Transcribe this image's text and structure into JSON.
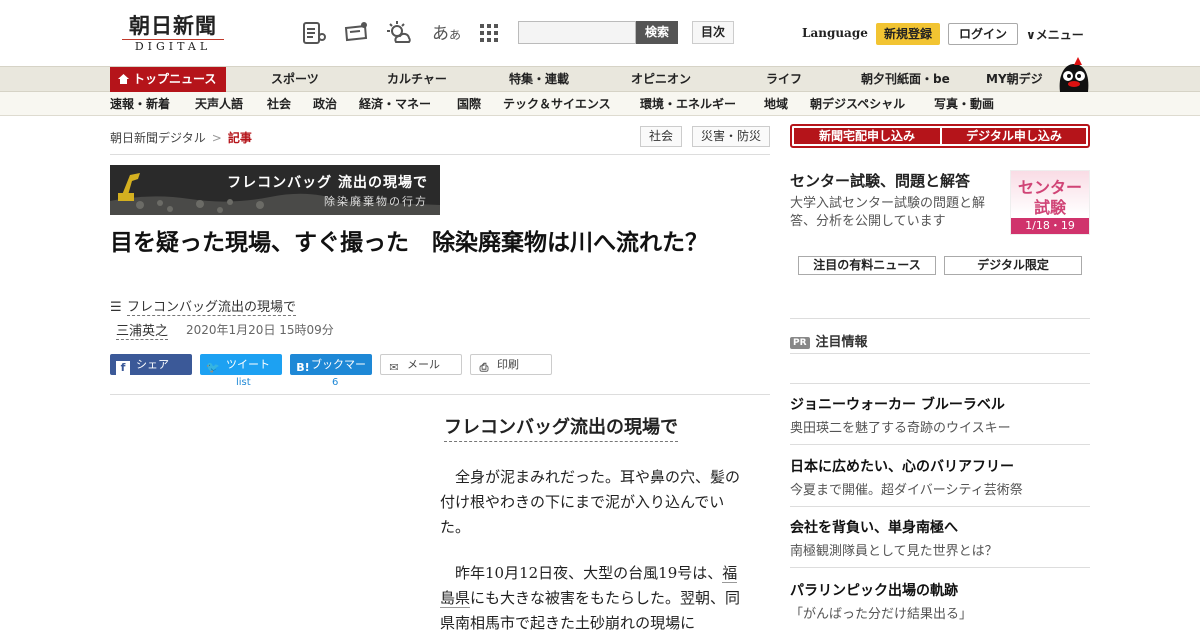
{
  "header": {
    "logo_main": "朝日新聞",
    "logo_sub": "DIGITAL",
    "aa": "あ",
    "aa_small": "あ",
    "search_button": "検索",
    "search_placeholder": "",
    "index_button": "目次",
    "language": "Language",
    "register": "新規登録",
    "login": "ログイン",
    "menu": "メニュー"
  },
  "nav_main": [
    "トップニュース",
    "スポーツ",
    "カルチャー",
    "特集・連載",
    "オピニオン",
    "ライフ",
    "朝夕刊紙面・be",
    "MY朝デジ"
  ],
  "nav_sub": [
    "速報・新着",
    "天声人語",
    "社会",
    "政治",
    "経済・マネー",
    "国際",
    "テック＆サイエンス",
    "環境・エネルギー",
    "地域",
    "朝デジスペシャル",
    "写真・動画"
  ],
  "breadcrumb": {
    "home": "朝日新聞デジタル",
    "sep": ">",
    "current": "記事"
  },
  "tags": [
    "社会",
    "災害・防災"
  ],
  "banner": {
    "title": "フレコンバッグ 流出の現場で",
    "subtitle": "除染廃棄物の行方"
  },
  "article": {
    "headline": "目を疑った現場、すぐ撮った　除染廃棄物は川へ流れた？",
    "series": "フレコンバッグ流出の現場で",
    "author": "三浦英之",
    "datetime": "2020年1月20日 15時09分",
    "body_series": "フレコンバッグ流出の現場で",
    "para1": "全身が泥まみれだった。耳や鼻の穴、髪の付け根やわきの下にまで泥が入り込んでいた。",
    "para2_a": "昨年10月12日夜、大型の台風19号は、",
    "para2_link1": "福島県",
    "para2_b": "にも大きな被害をもたらした。翌朝、同県",
    "para2_link2": "南相馬市",
    "para2_c": "で起きた",
    "para2_link3": "土砂崩れ",
    "para2_d": "の現場に"
  },
  "share": {
    "facebook": "シェア",
    "twitter": "ツイート",
    "hatena": "ブックマーク",
    "mail": "メール",
    "print": "印刷",
    "twitter_count": "list",
    "hatena_count": "6"
  },
  "sidebar": {
    "subscribe_paper": "新聞宅配申し込み",
    "subscribe_digital": "デジタル申し込み",
    "exam_title": "センター試験、問題と解答",
    "exam_desc": "大学入試センター試験の問題と解答、分析を公開しています",
    "exam_img_l1": "センター",
    "exam_img_l2": "試験",
    "exam_img_date": "1/18・19",
    "tab_paid": "注目の有料ニュース",
    "tab_digital": "デジタル限定",
    "pr_badge": "PR",
    "pr_heading": "注目情報",
    "pr_items": [
      {
        "title": "ジョニーウォーカー ブルーラベル",
        "sub": "奥田瑛二を魅了する奇跡のウイスキー"
      },
      {
        "title": "日本に広めたい、心のバリアフリー",
        "sub": "今夏まで開催。超ダイバーシティ芸術祭"
      },
      {
        "title": "会社を背負い、単身南極へ",
        "sub": "南極観測隊員として見た世界とは？"
      },
      {
        "title": "パラリンピック出場の軌跡",
        "sub": "「がんばった分だけ結果出る」"
      }
    ]
  },
  "colors": {
    "brand_red": "#b5141a",
    "nav_bg": "#e9e7dd",
    "register_yellow": "#f2c432"
  }
}
